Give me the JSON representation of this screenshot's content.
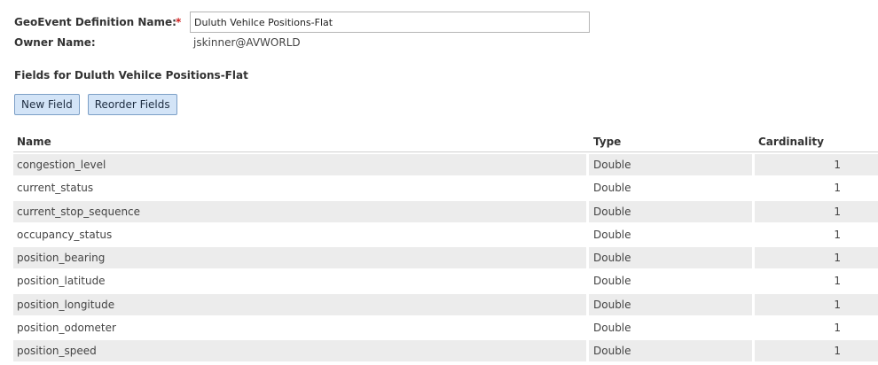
{
  "form": {
    "definition_label": "GeoEvent Definition Name:",
    "required_mark": "*",
    "definition_value": "Duluth Vehilce Positions-Flat",
    "owner_label": "Owner Name:",
    "owner_value": "jskinner@AVWORLD"
  },
  "fields_section": {
    "title": "Fields for Duluth Vehilce Positions-Flat"
  },
  "buttons": {
    "new_field": "New Field",
    "reorder_fields": "Reorder Fields"
  },
  "table": {
    "headers": {
      "name": "Name",
      "type": "Type",
      "cardinality": "Cardinality"
    },
    "rows": [
      {
        "name": "congestion_level",
        "type": "Double",
        "cardinality": "1"
      },
      {
        "name": "current_status",
        "type": "Double",
        "cardinality": "1"
      },
      {
        "name": "current_stop_sequence",
        "type": "Double",
        "cardinality": "1"
      },
      {
        "name": "occupancy_status",
        "type": "Double",
        "cardinality": "1"
      },
      {
        "name": "position_bearing",
        "type": "Double",
        "cardinality": "1"
      },
      {
        "name": "position_latitude",
        "type": "Double",
        "cardinality": "1"
      },
      {
        "name": "position_longitude",
        "type": "Double",
        "cardinality": "1"
      },
      {
        "name": "position_odometer",
        "type": "Double",
        "cardinality": "1"
      },
      {
        "name": "position_speed",
        "type": "Double",
        "cardinality": "1"
      }
    ]
  }
}
